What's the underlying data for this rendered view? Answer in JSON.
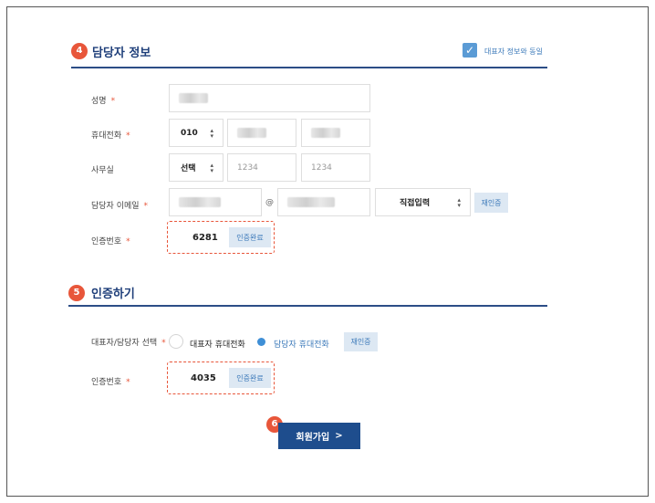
{
  "section4": {
    "number": "4",
    "title": "담당자 정보",
    "same_as_rep_label": "대표자 정보와 동일"
  },
  "fields": {
    "name": {
      "label": "성명",
      "required": "*"
    },
    "mobile": {
      "label": "휴대전화",
      "required": "*",
      "prefix": "010"
    },
    "office": {
      "label": "사무실",
      "prefix": "선택",
      "part2_placeholder": "1234",
      "part3_placeholder": "1234"
    },
    "email": {
      "label": "담당자 이메일",
      "required": "*",
      "at": "@",
      "domain_select": "직접입력",
      "reauth_label": "재인증"
    },
    "auth_code": {
      "label": "인증번호",
      "required": "*",
      "value": "6281",
      "status": "인증완료"
    }
  },
  "section5": {
    "number": "5",
    "title": "인증하기",
    "choose_label": "대표자/담당자 선택",
    "required": "*",
    "options": [
      "대표자 휴대전화",
      "담당자 휴대전화"
    ],
    "reauth_label": "재인증",
    "auth_label": "인증번호",
    "auth_value": "4035",
    "auth_status": "인증완료"
  },
  "submit": {
    "number": "6",
    "label": "회원가입",
    "arrow": ">"
  },
  "colors": {
    "accent": "#e8563a",
    "primary": "#1e4d8d",
    "light_button": "#dde8f3"
  }
}
